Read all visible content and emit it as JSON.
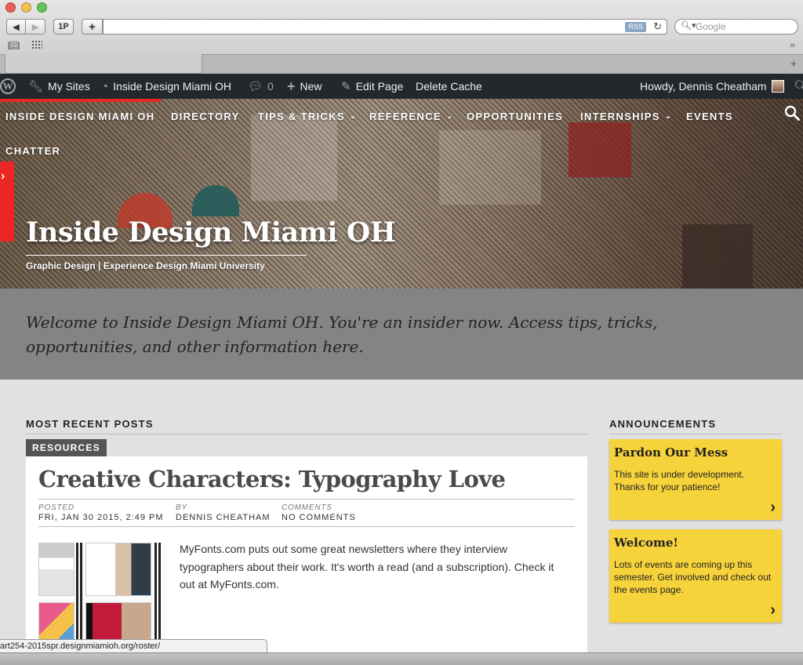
{
  "browser": {
    "back_label": "◀",
    "forward_label": "▶",
    "onep_label": "1P",
    "plus_label": "+",
    "url": "",
    "rss_label": "RSS",
    "search_placeholder": "Google",
    "more_label": "»",
    "newtab_label": "+"
  },
  "adminbar": {
    "my_sites": "My Sites",
    "site_name": "Inside Design Miami OH",
    "comments_count": "0",
    "new_label": "New",
    "edit_page": "Edit Page",
    "delete_cache": "Delete Cache",
    "greeting": "Howdy, Dennis Cheatham"
  },
  "nav": {
    "items": [
      {
        "label": "INSIDE DESIGN MIAMI OH"
      },
      {
        "label": "DIRECTORY"
      },
      {
        "label": "TIPS & TRICKS"
      },
      {
        "label": "REFERENCE"
      },
      {
        "label": "OPPORTUNITIES"
      },
      {
        "label": "INTERNSHIPS"
      },
      {
        "label": "EVENTS"
      },
      {
        "label": "CHATTER"
      }
    ]
  },
  "hero": {
    "title": "Inside Design Miami OH",
    "tagline": "Graphic Design | Experience Design   Miami University"
  },
  "welcome": {
    "text": "Welcome to Inside Design Miami OH. You're an insider now. Access tips, tricks, opportunities, and other information here."
  },
  "main": {
    "section_title": "MOST RECENT POSTS",
    "post": {
      "category": "RESOURCES",
      "title": "Creative Characters: Typography Love",
      "posted_label": "POSTED",
      "posted_value": "FRI, JAN 30 2015, 2:49 PM",
      "by_label": "BY",
      "by_value": "DENNIS CHEATHAM",
      "comments_label": "COMMENTS",
      "comments_value": "NO COMMENTS",
      "excerpt": "MyFonts.com puts out some great newsletters where they interview typographers about their work. It's worth a read (and a subscription). Check it out at MyFonts.com."
    }
  },
  "sidebar": {
    "title": "ANNOUNCEMENTS",
    "cards": [
      {
        "title": "Pardon Our Mess",
        "body": "This site is under development. Thanks for your patience!"
      },
      {
        "title": "Welcome!",
        "body": "Lots of events are coming up this semester. Get involved and check out the events page."
      }
    ]
  },
  "status": {
    "url": "art254-2015spr.designmiamioh.org/roster/"
  },
  "colors": {
    "accent_red": "#ec2624",
    "announcement_yellow": "#f7d33b",
    "adminbar_bg": "#23282d"
  }
}
